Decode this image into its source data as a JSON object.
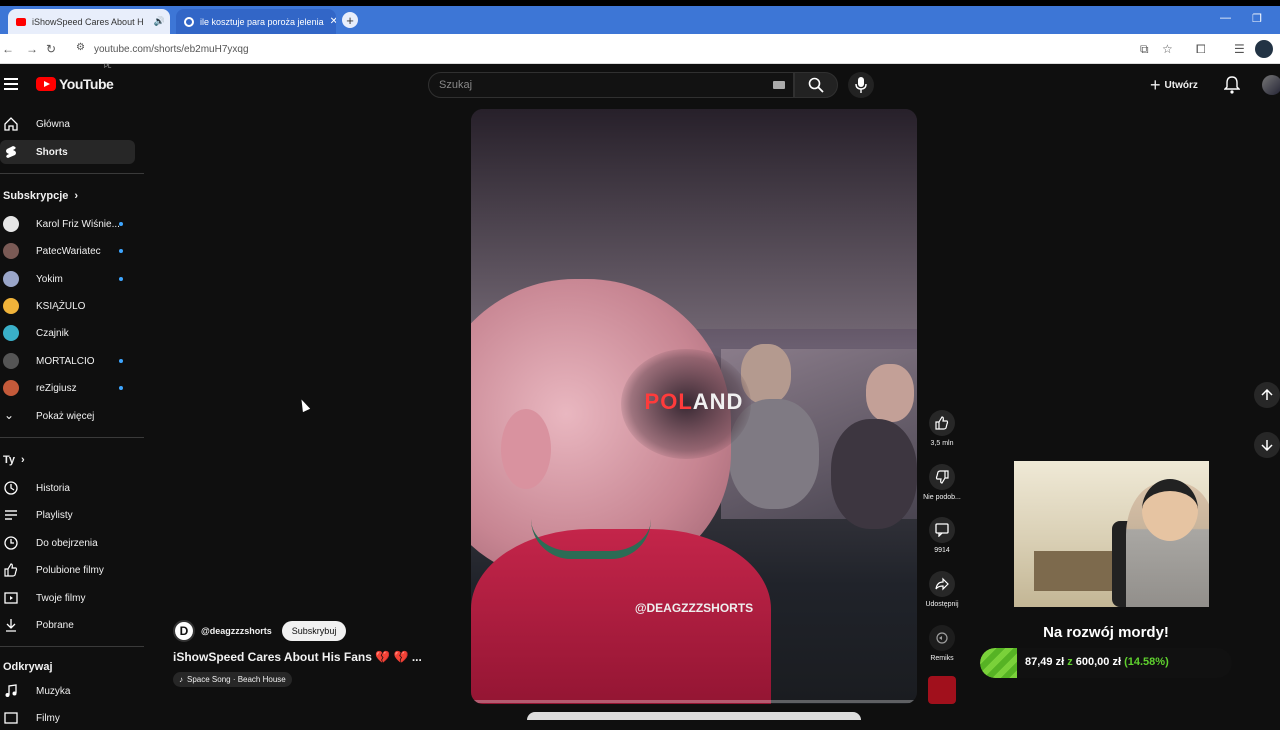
{
  "browser": {
    "tabs": [
      {
        "title": "iShowSpeed Cares About H",
        "active": true
      },
      {
        "title": "ile kosztuje para poroża jelenia",
        "active": false
      }
    ],
    "url": "youtube.com/shorts/eb2muH7yxqg"
  },
  "masthead": {
    "logo": "YouTube",
    "region": "PL",
    "search_placeholder": "Szukaj",
    "create_label": "Utwórz"
  },
  "sidebar": {
    "main": [
      {
        "label": "Główna",
        "icon": "home-icon"
      },
      {
        "label": "Shorts",
        "icon": "shorts-icon",
        "selected": true
      }
    ],
    "subs_header": "Subskrypcje",
    "subscriptions": [
      {
        "label": "Karol Friz Wiśnie...",
        "new": true,
        "color": "#e6e6e6"
      },
      {
        "label": "PatecWariatec",
        "new": true,
        "color": "#7a5a55"
      },
      {
        "label": "Yokim",
        "new": true,
        "color": "#9aa6c9"
      },
      {
        "label": "KSIĄŻULO",
        "new": false,
        "color": "#f0b33a"
      },
      {
        "label": "Czajnik",
        "new": false,
        "color": "#3ab0c9"
      },
      {
        "label": "MORTALCIO",
        "new": true,
        "color": "#555555"
      },
      {
        "label": "reZigiusz",
        "new": true,
        "color": "#c45a3a"
      }
    ],
    "show_more": "Pokaż więcej",
    "you_header": "Ty",
    "you": [
      {
        "label": "Historia",
        "icon": "history-icon"
      },
      {
        "label": "Playlisty",
        "icon": "playlist-icon"
      },
      {
        "label": "Do obejrzenia",
        "icon": "watch-later-icon"
      },
      {
        "label": "Polubione filmy",
        "icon": "like-icon"
      },
      {
        "label": "Twoje filmy",
        "icon": "your-videos-icon"
      },
      {
        "label": "Pobrane",
        "icon": "download-icon"
      }
    ],
    "explore_header": "Odkrywaj",
    "explore": [
      {
        "label": "Muzyka",
        "icon": "music-icon"
      },
      {
        "label": "Filmy",
        "icon": "film-icon"
      }
    ]
  },
  "video": {
    "overlay_red": "POL",
    "overlay_white": "AND",
    "watermark": "@DEAGZZZSHORTS",
    "channel": "@deagzzzshorts",
    "channel_initial": "D",
    "subscribe": "Subskrybuj",
    "title": "iShowSpeed Cares About His Fans",
    "title_emojis": "💔 💔",
    "title_more": "...",
    "song": "Space Song · Beach House"
  },
  "actions": {
    "likes": "3,5 mln",
    "dislike": "Nie podob...",
    "comments": "9914",
    "share": "Udostępnij",
    "remix": "Remiks"
  },
  "overlay": {
    "goal_title": "Na rozwój mordy!",
    "goal_current": "87,49 zł",
    "goal_sep": "z",
    "goal_target": "600,00 zł",
    "goal_percent": "(14.58%)",
    "goal_fraction": 0.1458
  }
}
